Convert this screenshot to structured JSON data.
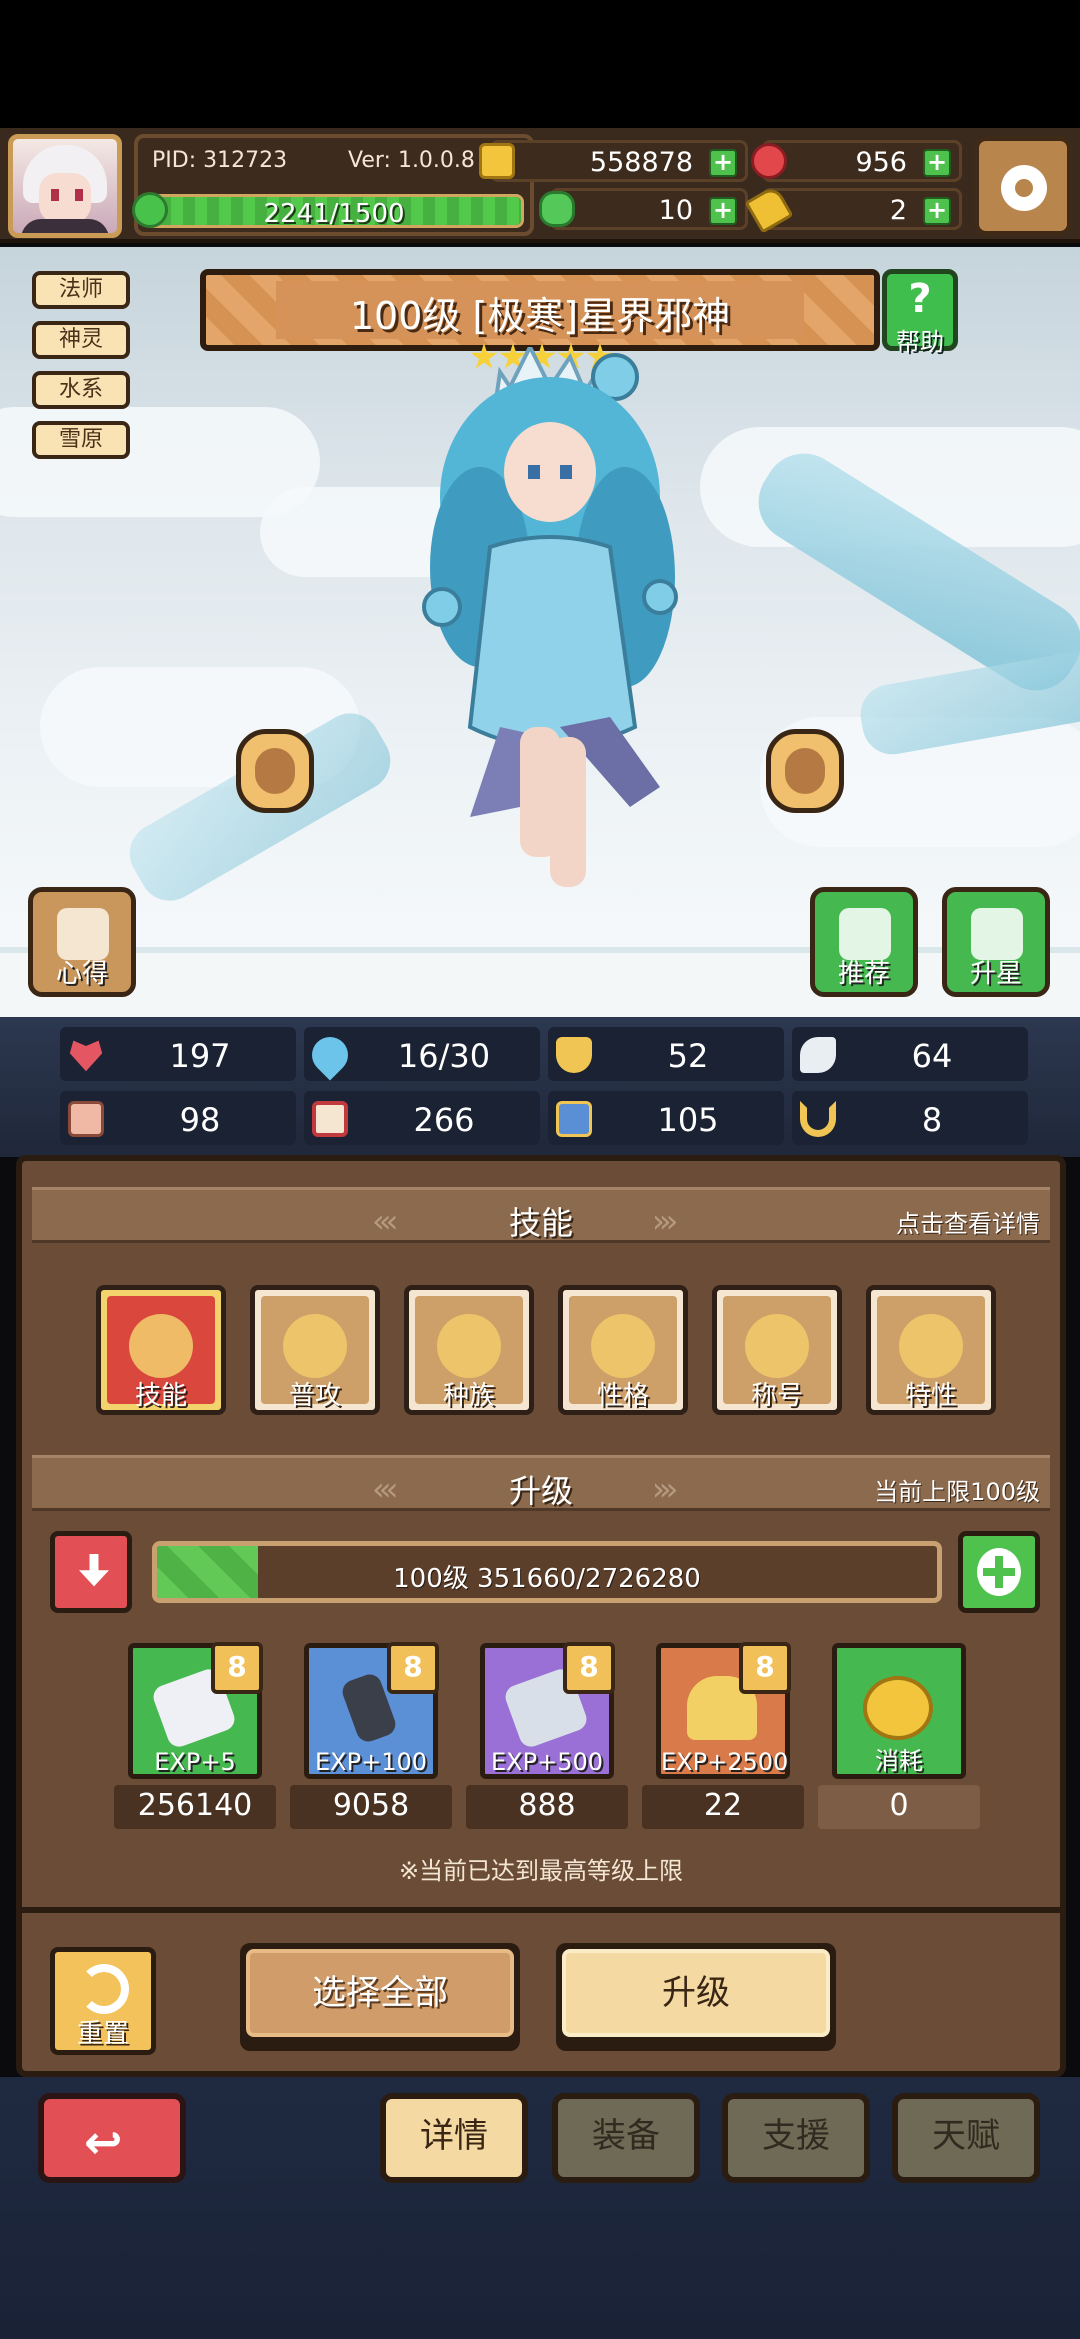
{
  "header": {
    "pid": "PID: 312723",
    "version": "Ver: 1.0.0.8",
    "exp_text": "2241/1500",
    "exp_fraction": 1.0,
    "gold": "558878",
    "gems": "956",
    "clovers": "10",
    "keys": "2"
  },
  "tags": [
    "法师",
    "神灵",
    "水系",
    "雪原"
  ],
  "hero": {
    "title": "100级 [极寒]星界邪神",
    "stars": 5,
    "help_label": "帮助"
  },
  "side_buttons": {
    "left": "心得",
    "recommend": "推荐",
    "star_up": "升星"
  },
  "stats": [
    {
      "icon": "heart-icon",
      "value": "197"
    },
    {
      "icon": "mana-drop-icon",
      "value": "16/30"
    },
    {
      "icon": "shield-icon",
      "value": "52"
    },
    {
      "icon": "wing-icon",
      "value": "64"
    },
    {
      "icon": "fist-icon",
      "value": "98"
    },
    {
      "icon": "spellbook-icon",
      "value": "266"
    },
    {
      "icon": "magic-shield-icon",
      "value": "105"
    },
    {
      "icon": "magnet-icon",
      "value": "8"
    }
  ],
  "skills_section": {
    "title": "技能",
    "hint": "点击查看详情",
    "items": [
      "技能",
      "普攻",
      "种族",
      "性格",
      "称号",
      "特性"
    ]
  },
  "upgrade_section": {
    "title": "升级",
    "hint": "当前上限100级",
    "level_text": "100级  351660/2726280",
    "progress": 0.129,
    "items": [
      {
        "label": "EXP+5",
        "count": "256140"
      },
      {
        "label": "EXP+100",
        "count": "9058"
      },
      {
        "label": "EXP+500",
        "count": "888"
      },
      {
        "label": "EXP+2500",
        "count": "22"
      },
      {
        "label": "消耗",
        "count": "0"
      }
    ],
    "note": "※当前已达到最高等级上限"
  },
  "actions": {
    "reset": "重置",
    "select_all": "选择全部",
    "upgrade": "升级"
  },
  "nav": {
    "tabs": [
      "详情",
      "装备",
      "支援",
      "天赋"
    ]
  },
  "colors": {
    "panel": "#6b4c36",
    "accent_green": "#4ec24c",
    "accent_red": "#e24f55",
    "cream": "#f4d9a2"
  }
}
